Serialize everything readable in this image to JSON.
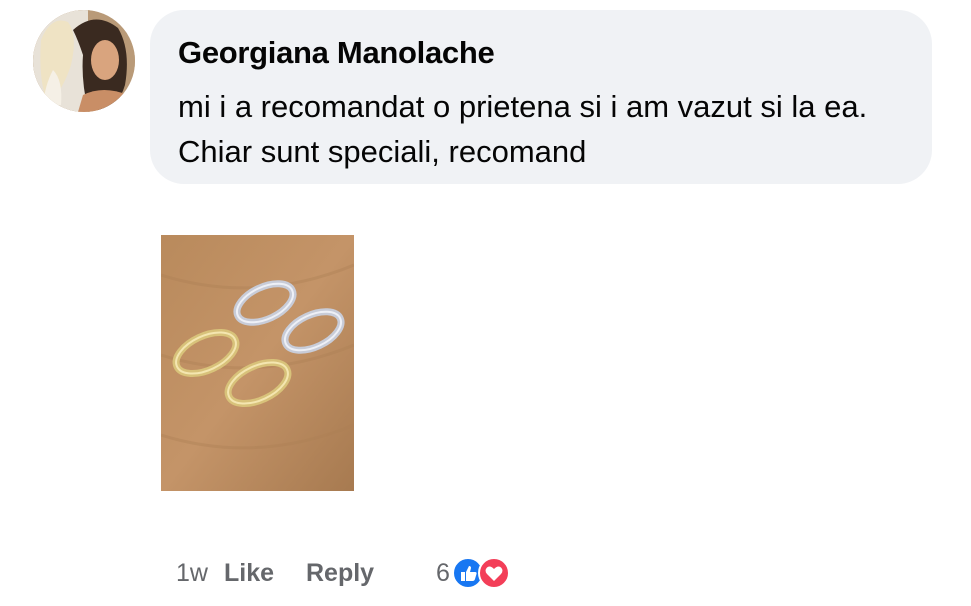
{
  "comment": {
    "author": "Georgiana Manolache",
    "text": "mi i a recomandat o prietena si i am vazut si la ea. Chiar sunt speciali, recomand",
    "avatar_icon": "profile-photo",
    "attachment_icon": "photo-hoop-earrings"
  },
  "footer": {
    "time": "1w",
    "like_label": "Like",
    "reply_label": "Reply",
    "reaction_count": "6",
    "reaction_icons": [
      "like-icon",
      "love-icon"
    ]
  },
  "colors": {
    "bubble": "#f0f2f5",
    "meta_text": "#65676b",
    "like_blue": "#1877f2",
    "love_red": "#f33e58"
  }
}
